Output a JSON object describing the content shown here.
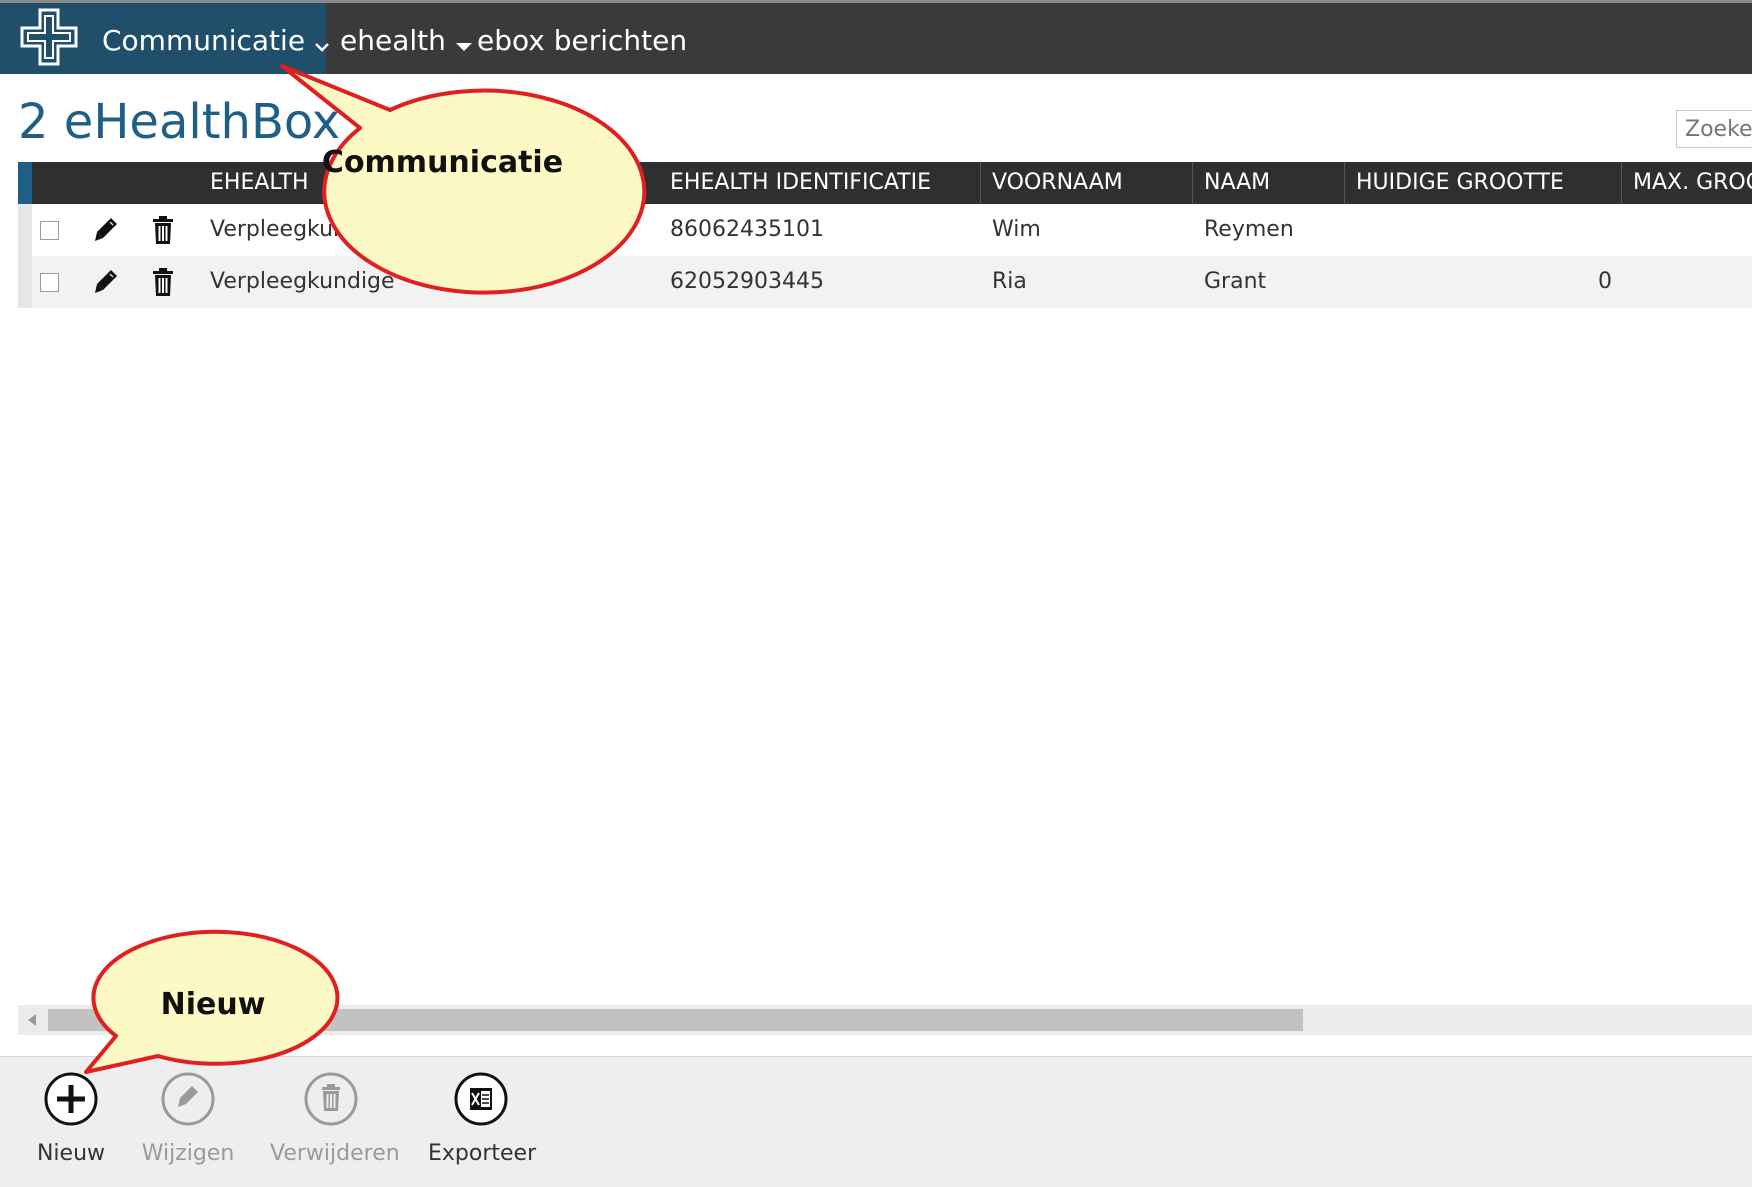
{
  "nav": {
    "items": [
      {
        "label": "Communicatie"
      },
      {
        "label": "ehealth"
      },
      {
        "label": "ebox berichten"
      }
    ]
  },
  "page": {
    "title": "2 eHealthBox"
  },
  "search": {
    "placeholder": "Zoeken"
  },
  "grid": {
    "columns": [
      {
        "label": "EHEALTH"
      },
      {
        "label": "EHEALTH IDENTIFICATIE"
      },
      {
        "label": "VOORNAAM"
      },
      {
        "label": "NAAM"
      },
      {
        "label": "HUIDIGE GROOTTE"
      },
      {
        "label": "MAX. GROOTTE"
      }
    ],
    "rows": [
      {
        "type": "Verpleegkundige",
        "id": "86062435101",
        "voornaam": "Wim",
        "naam": "Reymen",
        "huidige": "",
        "max": ""
      },
      {
        "type": "Verpleegkundige",
        "id": "62052903445",
        "voornaam": "Ria",
        "naam": "Grant",
        "huidige": "0",
        "max": ""
      }
    ]
  },
  "toolbar": {
    "new_label": "Nieuw",
    "edit_label": "Wijzigen",
    "delete_label": "Verwijderen",
    "export_label": "Exporteer"
  },
  "callouts": {
    "communicatie": "Communicatie",
    "nieuw": "Nieuw"
  },
  "colors": {
    "brand": "#1f4f6b",
    "title": "#1f5f86",
    "topbar": "#3a3a3a",
    "callout_fill": "#fdf9c4",
    "callout_stroke": "#e02020"
  },
  "icons": [
    "logo-icon",
    "chevron-down-icon",
    "caret-down-icon",
    "sort-asc-icon",
    "pencil-icon",
    "trash-icon",
    "plus-icon",
    "excel-icon",
    "scroll-left-icon"
  ]
}
